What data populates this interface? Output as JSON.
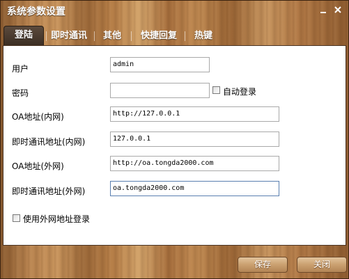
{
  "window": {
    "title": "系统参数设置",
    "minimize_glyph": "_",
    "close_glyph": "✕"
  },
  "tabs": [
    {
      "label": "登陆",
      "active": true
    },
    {
      "label": "即时通讯",
      "active": false
    },
    {
      "label": "其他",
      "active": false
    },
    {
      "label": "快捷回复",
      "active": false
    },
    {
      "label": "热键",
      "active": false
    }
  ],
  "form": {
    "user_label": "用户",
    "user_value": "admin",
    "password_label": "密码",
    "password_value": "",
    "auto_login_label": "自动登录",
    "auto_login_checked": false,
    "oa_internal_label": "OA地址(内网)",
    "oa_internal_value": "http://127.0.0.1",
    "im_internal_label": "即时通讯地址(内网)",
    "im_internal_value": "127.0.0.1",
    "oa_external_label": "OA地址(外网)",
    "oa_external_value": "http://oa.tongda2000.com",
    "im_external_label": "即时通讯地址(外网)",
    "im_external_value": "oa.tongda2000.com",
    "use_external_label": "使用外网地址登录",
    "use_external_checked": false
  },
  "buttons": {
    "save": "保存",
    "close": "关闭"
  },
  "icons": {
    "minimize": "minimize-icon",
    "close": "close-icon"
  }
}
